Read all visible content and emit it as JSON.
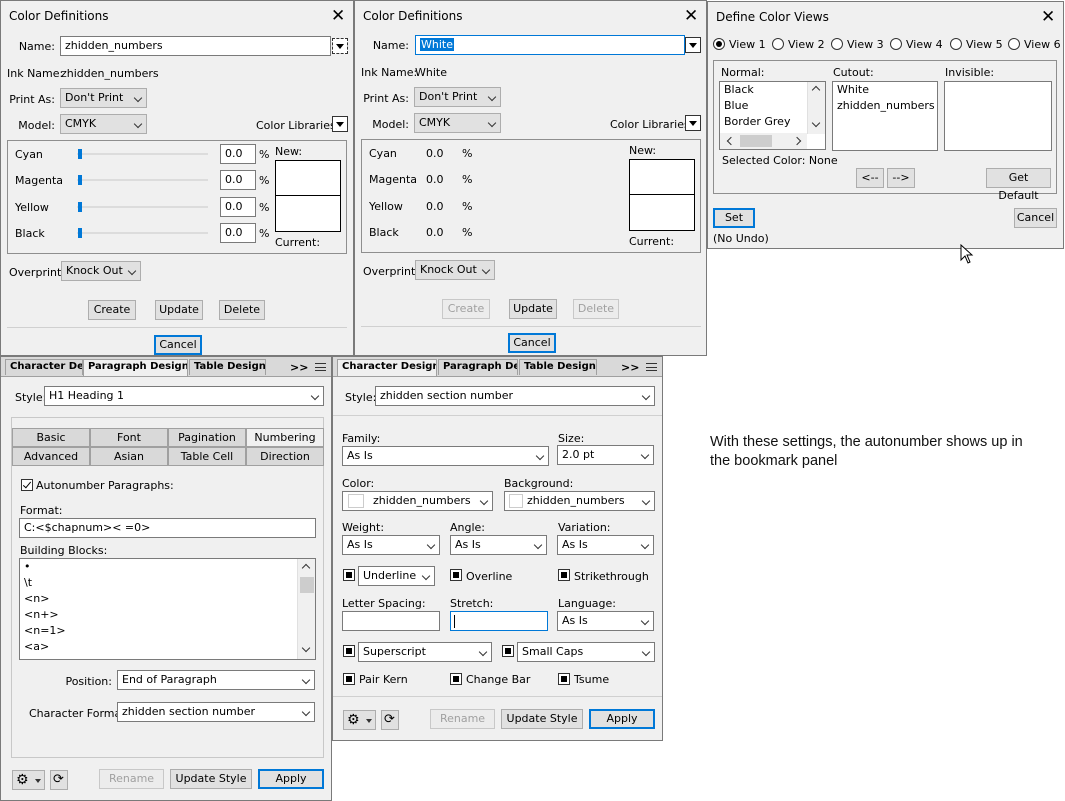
{
  "cd1": {
    "title": "Color Definitions",
    "name_label": "Name:",
    "name_value": "zhidden_numbers",
    "ink_label": "Ink Name:",
    "ink_value": "zhidden_numbers",
    "printas_label": "Print As:",
    "printas_value": "Don't Print",
    "model_label": "Model:",
    "model_value": "CMYK",
    "libs_label": "Color Libraries:",
    "channels": [
      {
        "label": "Cyan",
        "value": "0.0",
        "unit": "%"
      },
      {
        "label": "Magenta",
        "value": "0.0",
        "unit": "%"
      },
      {
        "label": "Yellow",
        "value": "0.0",
        "unit": "%"
      },
      {
        "label": "Black",
        "value": "0.0",
        "unit": "%"
      }
    ],
    "new_label": "New:",
    "current_label": "Current:",
    "overprint_label": "Overprint:",
    "overprint_value": "Knock Out",
    "create": "Create",
    "update": "Update",
    "delete": "Delete",
    "cancel": "Cancel"
  },
  "cd2": {
    "title": "Color Definitions",
    "name_label": "Name:",
    "name_value": "White",
    "ink_label": "Ink Name:",
    "ink_value": "White",
    "printas_label": "Print As:",
    "printas_value": "Don't Print",
    "model_label": "Model:",
    "model_value": "CMYK",
    "libs_label": "Color Libraries:",
    "channels": [
      {
        "label": "Cyan",
        "value": "0.0",
        "unit": "%"
      },
      {
        "label": "Magenta",
        "value": "0.0",
        "unit": "%"
      },
      {
        "label": "Yellow",
        "value": "0.0",
        "unit": "%"
      },
      {
        "label": "Black",
        "value": "0.0",
        "unit": "%"
      }
    ],
    "new_label": "New:",
    "current_label": "Current:",
    "overprint_label": "Overprint:",
    "overprint_value": "Knock Out",
    "create": "Create",
    "update": "Update",
    "delete": "Delete",
    "cancel": "Cancel"
  },
  "views": {
    "title": "Define Color Views",
    "radios": [
      "View 1",
      "View 2",
      "View 3",
      "View 4",
      "View 5",
      "View 6"
    ],
    "normal_label": "Normal:",
    "cutout_label": "Cutout:",
    "invisible_label": "Invisible:",
    "normal_items": [
      "Black",
      "Blue",
      "Border Grey"
    ],
    "cutout_items": [
      "White",
      "zhidden_numbers"
    ],
    "selected_color": "Selected Color: None",
    "left_btn": "<--",
    "right_btn": "-->",
    "get_default": "Get Default",
    "set": "Set",
    "no_undo": "(No Undo)",
    "cancel": "Cancel"
  },
  "pd": {
    "tabs": [
      "Character Desig",
      "Paragraph Designer",
      "Table Designer"
    ],
    "more": ">>",
    "style_label": "Style:",
    "style_value": "H1 Heading 1",
    "subtabs": [
      "Basic",
      "Font",
      "Pagination",
      "Numbering",
      "Advanced",
      "Asian",
      "Table Cell",
      "Direction"
    ],
    "autonumber_label": "Autonumber Paragraphs:",
    "format_label": "Format:",
    "format_value": "C:<$chapnum>< =0>",
    "blocks_label": "Building Blocks:",
    "blocks": [
      "•",
      "\\t",
      "<n>",
      "<n+>",
      "<n=1>",
      "<a>"
    ],
    "position_label": "Position:",
    "position_value": "End of Paragraph",
    "charformat_label": "Character Format:",
    "charformat_value": "zhidden section number",
    "rename": "Rename",
    "update_style": "Update Style",
    "apply": "Apply"
  },
  "chd": {
    "tabs": [
      "Character Designer",
      "Paragraph Desig",
      "Table Designer"
    ],
    "more": ">>",
    "style_label": "Style:",
    "style_value": "zhidden section number",
    "family_label": "Family:",
    "family_value": "As Is",
    "size_label": "Size:",
    "size_value": "2.0 pt",
    "color_label": "Color:",
    "color_value": "zhidden_numbers",
    "background_label": "Background:",
    "background_value": "zhidden_numbers",
    "weight_label": "Weight:",
    "weight_value": "As Is",
    "angle_label": "Angle:",
    "angle_value": "As Is",
    "variation_label": "Variation:",
    "variation_value": "As Is",
    "underline_value": "Underline",
    "overline": "Overline",
    "strikethrough": "Strikethrough",
    "letterspacing_label": "Letter Spacing:",
    "stretch_label": "Stretch:",
    "language_label": "Language:",
    "language_value": "As Is",
    "superscript_value": "Superscript",
    "smallcaps_value": "Small Caps",
    "pairkern": "Pair Kern",
    "changebar": "Change Bar",
    "tsume": "Tsume",
    "rename": "Rename",
    "update_style": "Update Style",
    "apply": "Apply"
  },
  "note": "With these settings, the autonumber shows up in the bookmark panel"
}
